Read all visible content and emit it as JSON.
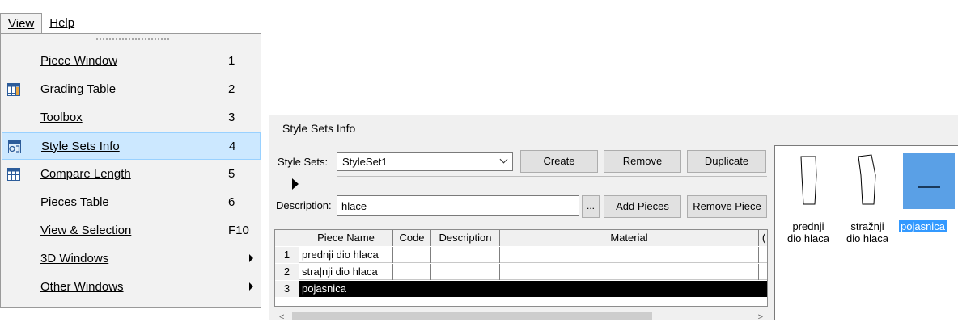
{
  "menubar": {
    "view": "View",
    "help": "Help"
  },
  "menu": {
    "items": [
      {
        "label": "Piece Window",
        "shortcut": "1",
        "icon": ""
      },
      {
        "label": "Grading Table",
        "shortcut": "2",
        "icon": "grading-table-icon"
      },
      {
        "label": "Toolbox",
        "shortcut": "3",
        "icon": ""
      },
      {
        "label": "Style Sets Info",
        "shortcut": "4",
        "icon": "style-sets-icon",
        "highlighted": true
      },
      {
        "label": "Compare Length",
        "shortcut": "5",
        "icon": "compare-length-icon"
      },
      {
        "label": "Pieces Table",
        "shortcut": "6",
        "icon": ""
      },
      {
        "label": "View & Selection",
        "shortcut": "F10",
        "icon": ""
      },
      {
        "label": "3D Windows",
        "shortcut": "",
        "submenu": true
      },
      {
        "label": "Other Windows",
        "shortcut": "",
        "submenu": true
      }
    ]
  },
  "style_sets_info": {
    "title": "Style Sets Info",
    "style_sets_label": "Style Sets:",
    "style_set_value": "StyleSet1",
    "create_label": "Create",
    "remove_label": "Remove",
    "duplicate_label": "Duplicate",
    "description_label": "Description:",
    "description_value": "hlace",
    "browse_label": "...",
    "add_pieces_label": "Add Pieces",
    "remove_piece_label": "Remove Piece",
    "grid": {
      "headers": [
        "Piece Name",
        "Code",
        "Description",
        "Material",
        "("
      ],
      "rows": [
        {
          "num": "1",
          "name": "prednji dio hlaca",
          "code": "",
          "description": "",
          "material": ""
        },
        {
          "num": "2",
          "name": "stra|nji dio hlaca",
          "code": "",
          "description": "",
          "material": ""
        },
        {
          "num": "3",
          "name": "pojasnica",
          "code": "",
          "description": "",
          "material": "",
          "selected": true
        }
      ]
    },
    "scroll": {
      "left": "<",
      "right": ">"
    }
  },
  "pieces_preview": [
    {
      "label_line1": "prednji",
      "label_line2": "dio hlaca"
    },
    {
      "label_line1": "stražnji",
      "label_line2": "dio hlaca"
    },
    {
      "label_line1": "pojasnica",
      "label_line2": "",
      "selected": true
    }
  ],
  "colors": {
    "highlight": "#cce8ff",
    "selection": "#000000",
    "accent": "#3399ff"
  }
}
